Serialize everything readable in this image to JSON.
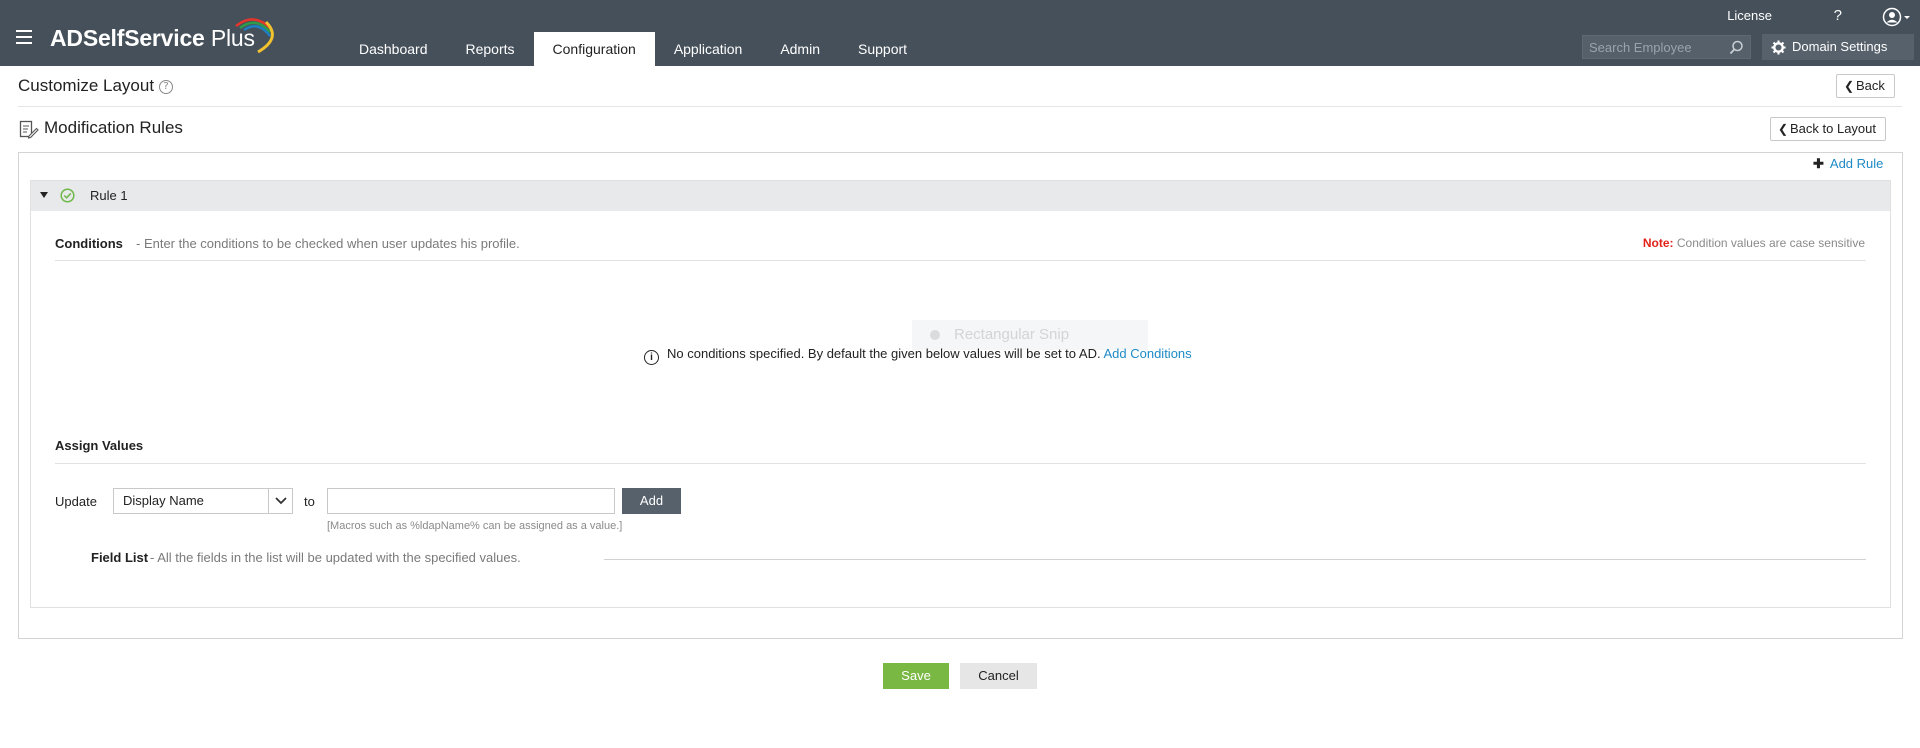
{
  "app": {
    "brand": "ADSelfService",
    "brand_suffix": "Plus",
    "license_label": "License",
    "help_label": "?"
  },
  "nav": {
    "tabs": [
      {
        "label": "Dashboard",
        "active": false
      },
      {
        "label": "Reports",
        "active": false
      },
      {
        "label": "Configuration",
        "active": true
      },
      {
        "label": "Application",
        "active": false
      },
      {
        "label": "Admin",
        "active": false
      },
      {
        "label": "Support",
        "active": false
      }
    ]
  },
  "search": {
    "placeholder": "Search Employee"
  },
  "domain_settings_label": "Domain Settings",
  "page": {
    "title": "Customize Layout",
    "help": "?",
    "back_label": "Back",
    "section_title": "Modification Rules",
    "back_to_layout_label": "Back to Layout",
    "add_rule_label": "Add Rule"
  },
  "rule": {
    "label": "Rule 1",
    "conditions_title": "Conditions",
    "conditions_desc": "- Enter the conditions to be checked when user updates his profile.",
    "note_label": "Note:",
    "note_text": "Condition values are case sensitive",
    "overlay_text": "Rectangular Snip",
    "no_conditions_text": "No conditions specified. By default the given below values will be set to AD.",
    "add_conditions_label": "Add Conditions",
    "assign_title": "Assign Values",
    "update_label": "Update",
    "select_value": "Display Name",
    "to_label": "to",
    "value_input": "",
    "add_label": "Add",
    "macros_hint": "[Macros such as %ldapName% can be assigned as a value.]",
    "field_list_title": "Field List",
    "field_list_desc": "- All the fields in the list will be updated with the specified values."
  },
  "actions": {
    "save_label": "Save",
    "cancel_label": "Cancel"
  },
  "colors": {
    "topbar": "#45505a",
    "accent_link": "#1f8ac6",
    "save_green": "#7ab844",
    "note_red": "#e2231a",
    "success_green": "#6fb84a"
  }
}
